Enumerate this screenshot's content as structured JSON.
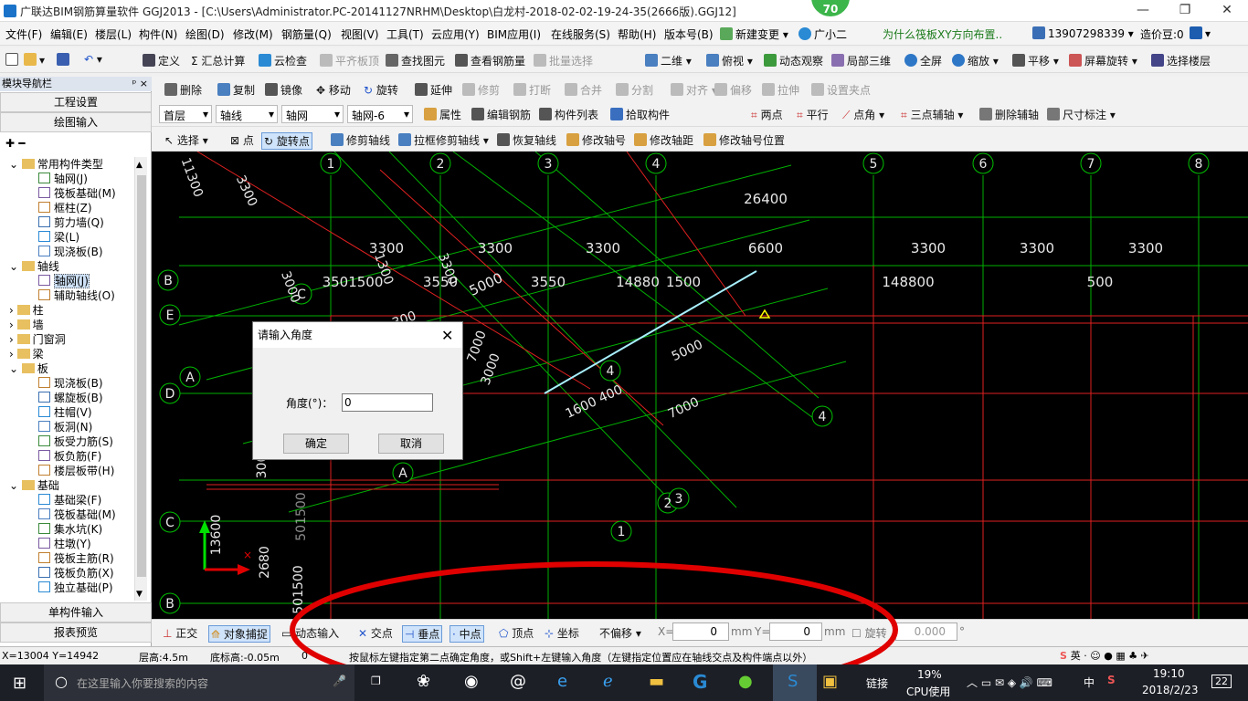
{
  "titlebar": {
    "title": "广联达BIM钢筋算量软件 GGJ2013 - [C:\\Users\\Administrator.PC-20141127NRHM\\Desktop\\白龙村-2018-02-02-19-24-35(2666版).GGJ12]",
    "badge": "70",
    "min": "—",
    "restore": "❐",
    "close": "✕"
  },
  "menu": {
    "items": [
      "文件(F)",
      "编辑(E)",
      "楼层(L)",
      "构件(N)",
      "绘图(D)",
      "修改(M)",
      "钢筋量(Q)",
      "视图(V)",
      "工具(T)",
      "云应用(Y)",
      "BIM应用(I)",
      "在线服务(S)",
      "帮助(H)",
      "版本号(B)"
    ],
    "new_change": "新建变更",
    "guangxiaoer": "广小二",
    "notice": "为什么筏板XY方向布置..",
    "phone": "13907298339",
    "price_bean": "造价豆:0"
  },
  "toolbar1": {
    "items": [
      "定义",
      "汇总计算",
      "云检查",
      "平齐板顶",
      "查找图元",
      "查看钢筋量",
      "批量选择",
      "二维",
      "俯视",
      "动态观察",
      "局部三维",
      "全屏",
      "缩放",
      "平移",
      "屏幕旋转",
      "选择楼层"
    ]
  },
  "toolbar2": {
    "items": [
      "删除",
      "复制",
      "镜像",
      "移动",
      "旋转",
      "延伸",
      "修剪",
      "打断",
      "合并",
      "分割",
      "对齐",
      "偏移",
      "拉伸",
      "设置夹点"
    ]
  },
  "toolbar3": {
    "floor": "首层",
    "type1": "轴线",
    "type2": "轴网",
    "type3": "轴网-6",
    "items": [
      "属性",
      "编辑钢筋",
      "构件列表",
      "拾取构件"
    ],
    "right_items": [
      "两点",
      "平行",
      "点角",
      "三点辅轴",
      "删除辅轴",
      "尺寸标注"
    ]
  },
  "toolbar4": {
    "items": [
      "选择",
      "点",
      "旋转点",
      "修剪轴线",
      "拉框修剪轴线",
      "恢复轴线",
      "修改轴号",
      "修改轴距",
      "修改轴号位置"
    ]
  },
  "left": {
    "header": "模块导航栏",
    "pin": "ᵖ ×",
    "btn_project": "工程设置",
    "btn_draw": "绘图输入",
    "btn_single": "单构件输入",
    "btn_report": "报表预览",
    "tree": [
      {
        "level": 0,
        "label": "常用构件类型",
        "folder": true,
        "open": true
      },
      {
        "level": 1,
        "label": "轴网(J)"
      },
      {
        "level": 1,
        "label": "筏板基础(M)"
      },
      {
        "level": 1,
        "label": "框柱(Z)"
      },
      {
        "level": 1,
        "label": "剪力墙(Q)"
      },
      {
        "level": 1,
        "label": "梁(L)"
      },
      {
        "level": 1,
        "label": "现浇板(B)"
      },
      {
        "level": 0,
        "label": "轴线",
        "folder": true,
        "open": true
      },
      {
        "level": 1,
        "label": "轴网(J)",
        "selected": true
      },
      {
        "level": 1,
        "label": "辅助轴线(O)"
      },
      {
        "level": 0,
        "label": "柱",
        "folder": true
      },
      {
        "level": 0,
        "label": "墙",
        "folder": true
      },
      {
        "level": 0,
        "label": "门窗洞",
        "folder": true
      },
      {
        "level": 0,
        "label": "梁",
        "folder": true
      },
      {
        "level": 0,
        "label": "板",
        "folder": true,
        "open": true
      },
      {
        "level": 1,
        "label": "现浇板(B)"
      },
      {
        "level": 1,
        "label": "螺旋板(B)"
      },
      {
        "level": 1,
        "label": "柱帽(V)"
      },
      {
        "level": 1,
        "label": "板洞(N)"
      },
      {
        "level": 1,
        "label": "板受力筋(S)"
      },
      {
        "level": 1,
        "label": "板负筋(F)"
      },
      {
        "level": 1,
        "label": "楼层板带(H)"
      },
      {
        "level": 0,
        "label": "基础",
        "folder": true,
        "open": true
      },
      {
        "level": 1,
        "label": "基础梁(F)"
      },
      {
        "level": 1,
        "label": "筏板基础(M)"
      },
      {
        "level": 1,
        "label": "集水坑(K)"
      },
      {
        "level": 1,
        "label": "柱墩(Y)"
      },
      {
        "level": 1,
        "label": "筏板主筋(R)"
      },
      {
        "level": 1,
        "label": "筏板负筋(X)"
      },
      {
        "level": 1,
        "label": "独立基础(P)"
      }
    ]
  },
  "canvas": {
    "top_axis_labels": [
      "1",
      "2",
      "3",
      "4",
      "5",
      "6",
      "7",
      "8"
    ],
    "left_axis_labels": [
      "B",
      "E",
      "A",
      "D",
      "C",
      "B"
    ],
    "dims_top": [
      "26400",
      "3300",
      "3300",
      "3300",
      "6600",
      "3300",
      "3300",
      "3300"
    ],
    "dims_row": [
      "3501500",
      "3550",
      "5000",
      "3550",
      "14880",
      "1500",
      "148800",
      "500"
    ],
    "rot_dims": [
      "11300",
      "3300",
      "3000",
      "1300",
      "3300",
      "7000",
      "3000",
      "5000",
      "7000",
      "1600 400",
      "300",
      "2680",
      "501500",
      "13600"
    ],
    "circle_labels": [
      "4",
      "4",
      "A",
      "2",
      "3",
      "1",
      "C"
    ],
    "left_dims": [
      "300",
      "0"
    ]
  },
  "dialog": {
    "title": "请输入角度",
    "label": "角度(°)：",
    "value": "0",
    "ok": "确定",
    "cancel": "取消"
  },
  "bottom": {
    "items": [
      "正交",
      "对象捕捉",
      "动态输入",
      "交点",
      "垂点",
      "中点",
      "顶点",
      "坐标"
    ],
    "offset_mode": "不偏移",
    "x_label": "X=",
    "x_value": "0",
    "unit1": "mm",
    "y_label": "Y=",
    "y_value": "0",
    "unit2": "mm",
    "rotate_label": "旋转",
    "rotate_value": "0.000",
    "deg": "°"
  },
  "status": {
    "coords": "X=13004 Y=14942",
    "floor_height": "层高:4.5m",
    "base_height": "底标高:-0.05m",
    "zero": "0",
    "hint": "按鼠标左键指定第二点确定角度，或Shift+左键输入角度（左键指定位置应在轴线交点及构件端点以外）"
  },
  "taskbar": {
    "search": "在这里输入你要搜索的内容",
    "link": "链接",
    "cpu": "19%",
    "cpu_label": "CPU使用",
    "ime": "中",
    "time": "19:10",
    "date": "2018/2/23",
    "notif": "22"
  },
  "colors": {
    "accent": "#0078d7",
    "annotation": "#e00000",
    "canvas": "#000000",
    "grid": "#00c000",
    "redline": "#ff2020"
  }
}
